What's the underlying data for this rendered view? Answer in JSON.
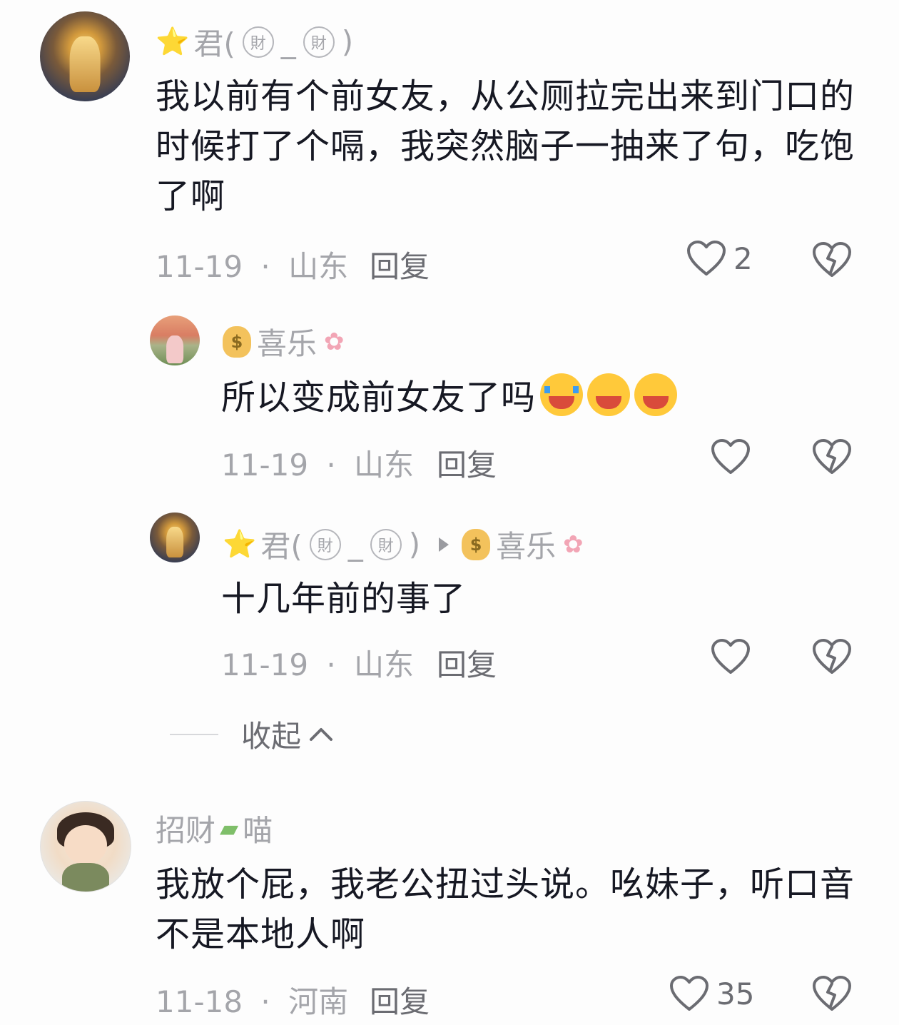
{
  "comments": [
    {
      "user": {
        "star": "⭐",
        "name_prefix": "君(",
        "char1": "財",
        "sep": "_",
        "char2": "財",
        "name_suffix": ")"
      },
      "text": "我以前有个前女友，从公厕拉完出来到门口的时候打了个嗝，我突然脑子一抽来了句，吃饱了啊",
      "date": "11-19",
      "dot": "·",
      "location": "山东",
      "reply_label": "回复",
      "likes": "2",
      "replies": [
        {
          "user": {
            "name": "喜乐"
          },
          "text": "所以变成前女友了吗",
          "emojis": [
            "loudly-crying-emoji",
            "rofl-emoji",
            "rofl-emoji"
          ],
          "date": "11-19",
          "dot": "·",
          "location": "山东",
          "reply_label": "回复",
          "likes": ""
        },
        {
          "user": {
            "star": "⭐",
            "name_prefix": "君(",
            "char1": "財",
            "sep": "_",
            "char2": "財",
            "name_suffix": ")"
          },
          "reply_to": "喜乐",
          "text": "十几年前的事了",
          "date": "11-19",
          "dot": "·",
          "location": "山东",
          "reply_label": "回复",
          "likes": ""
        }
      ],
      "collapse_label": "收起"
    },
    {
      "user": {
        "name_part1": "招财",
        "name_part2": "喵"
      },
      "text": "我放个屁，我老公扭过头说。吆妹子，听口音不是本地人啊",
      "date": "11-18",
      "dot": "·",
      "location": "河南",
      "reply_label": "回复",
      "likes": "35"
    }
  ],
  "icons": {
    "like": "heart-outline-icon",
    "dislike": "broken-heart-icon",
    "collapse": "chevron-up-icon"
  },
  "colors": {
    "text": "#161823",
    "muted": "#a4a5aa",
    "icon": "#6b6c72"
  }
}
